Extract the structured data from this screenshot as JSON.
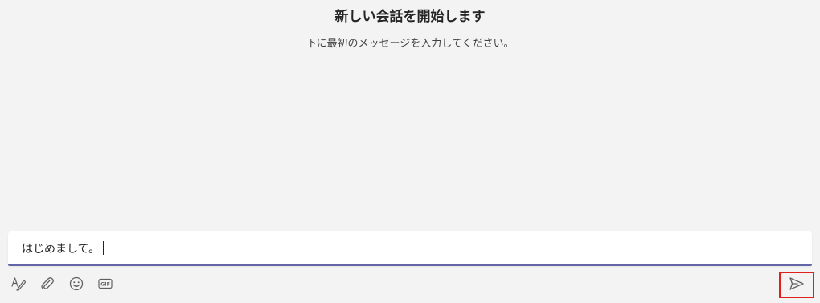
{
  "empty_state": {
    "title": "新しい会話を開始します",
    "subtitle": "下に最初のメッセージを入力してください。"
  },
  "compose": {
    "value": "はじめまして。"
  },
  "toolbar": {
    "icons": [
      "format-icon",
      "attach-icon",
      "emoji-icon",
      "gif-icon"
    ],
    "gif_label": "GIF"
  },
  "send": {
    "icon": "send-icon",
    "highlight_color": "#e0201b"
  },
  "colors": {
    "background": "#f3f3f3",
    "accent": "#6264a7",
    "icon": "#616161"
  }
}
